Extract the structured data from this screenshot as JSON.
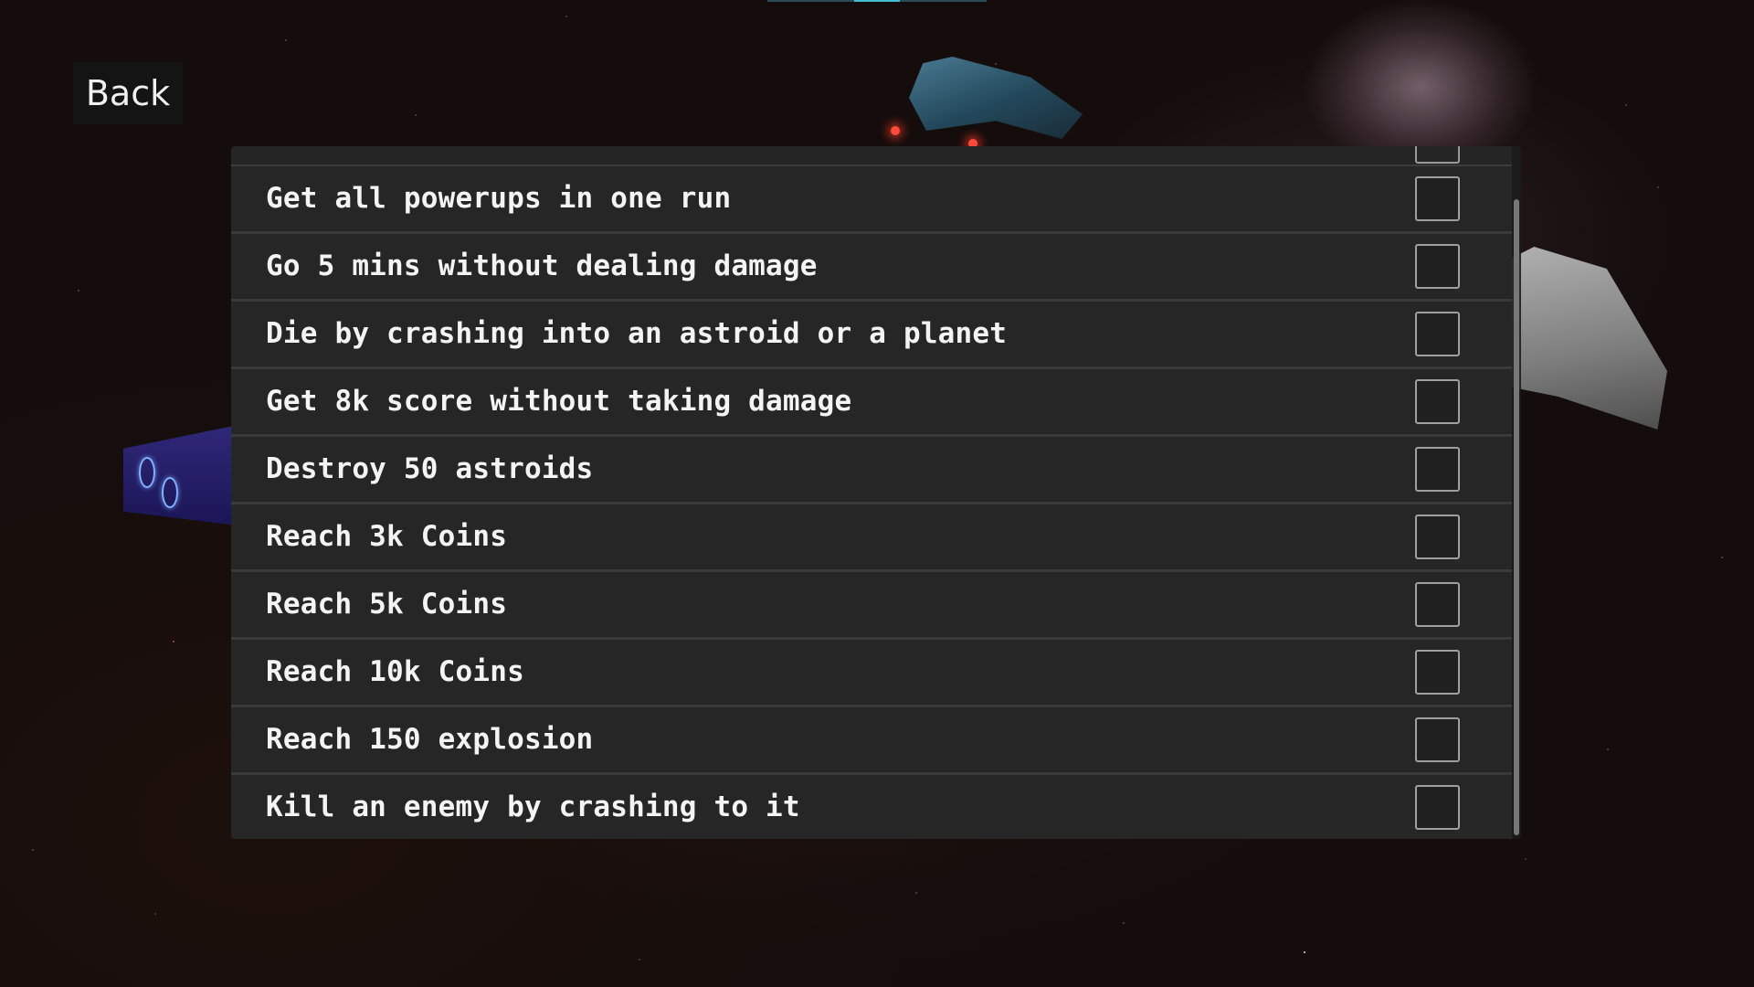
{
  "back_button": {
    "label": "Back"
  },
  "achievements": [
    {
      "label": "Get all powerups in one run",
      "completed": false
    },
    {
      "label": "Go 5 mins without dealing damage",
      "completed": false
    },
    {
      "label": "Die by crashing into an astroid or a planet",
      "completed": false
    },
    {
      "label": "Get 8k score without taking damage",
      "completed": false
    },
    {
      "label": "Destroy 50 astroids",
      "completed": false
    },
    {
      "label": "Reach 3k Coins",
      "completed": false
    },
    {
      "label": "Reach 5k Coins",
      "completed": false
    },
    {
      "label": "Reach 10k Coins",
      "completed": false
    },
    {
      "label": "Reach 150 explosion",
      "completed": false
    },
    {
      "label": "Kill an enemy by crashing to it",
      "completed": false
    }
  ],
  "colors": {
    "row_background": "#262626",
    "row_divider": "#3a3a3a",
    "text": "#f4f4f4",
    "checkbox_border": "#a0a0a0",
    "scroll_thumb": "#777777"
  }
}
